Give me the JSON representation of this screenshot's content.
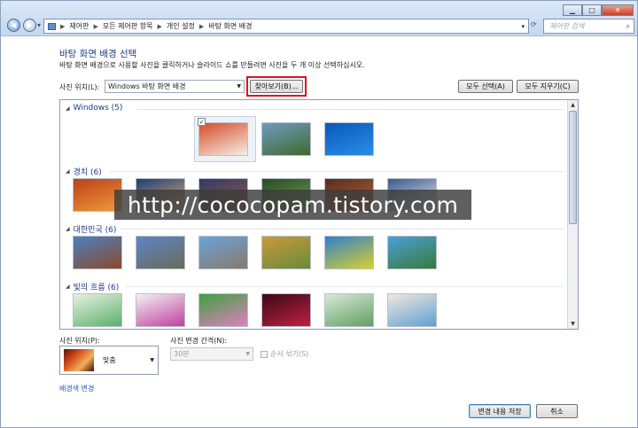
{
  "titlebar": {
    "controls": [
      "min",
      "max",
      "close"
    ],
    "address_crumbs": [
      "제어판",
      "모든 제어판 항목",
      "개인 설정",
      "바탕 화면 배경"
    ],
    "search_placeholder": "제어판 검색"
  },
  "page": {
    "title": "바탕 화면 배경 선택",
    "description": "바탕 화면 배경으로 사용할 사진을 클릭하거나 슬라이드 쇼를 만들려면 사진을 두 개 이상 선택하십시오."
  },
  "location": {
    "label": "사진 위치(L):",
    "value": "Windows 바탕 화면 배경",
    "browse_label": "찾아보기(B)..."
  },
  "actions": {
    "select_all": "모두 선택(A)",
    "clear_all": "모두 지우기(C)"
  },
  "gallery": {
    "groups": [
      {
        "label": "Windows (5)",
        "thumbs": [
          {
            "colors": [
              "#d84a2a",
              "#f5efe4"
            ],
            "name": "windows-thumb-1",
            "checked": true
          },
          {
            "colors": [
              "#6f9bc0",
              "#3f6a2b"
            ],
            "name": "windows-thumb-2"
          },
          {
            "colors": [
              "#0a58b8",
              "#2a8de8"
            ],
            "name": "windows-thumb-3"
          }
        ]
      },
      {
        "label": "경치 (6)",
        "thumbs": [
          {
            "colors": [
              "#b9401a",
              "#f29a3b"
            ],
            "name": "scenery-thumb-1"
          },
          {
            "colors": [
              "#1c3d7a",
              "#e7b36a"
            ],
            "name": "scenery-thumb-2"
          },
          {
            "colors": [
              "#2f3a6a",
              "#9b5a3a"
            ],
            "name": "scenery-thumb-3"
          },
          {
            "colors": [
              "#2a4a2a",
              "#6fa04f"
            ],
            "name": "scenery-thumb-4"
          },
          {
            "colors": [
              "#5a2a1a",
              "#b86a3a"
            ],
            "name": "scenery-thumb-5"
          },
          {
            "colors": [
              "#3a5a8a",
              "#f0f0f4"
            ],
            "name": "scenery-thumb-6"
          }
        ]
      },
      {
        "label": "대한민국 (6)",
        "thumbs": [
          {
            "colors": [
              "#4d7fbf",
              "#8a4a2a"
            ],
            "name": "korea-thumb-1"
          },
          {
            "colors": [
              "#5d86c4",
              "#6a6a5a"
            ],
            "name": "korea-thumb-2"
          },
          {
            "colors": [
              "#6aa3d8",
              "#8a7a6a"
            ],
            "name": "korea-thumb-3"
          },
          {
            "colors": [
              "#c89a3a",
              "#6a8a3a"
            ],
            "name": "korea-thumb-4"
          },
          {
            "colors": [
              "#2f7fd0",
              "#d8d02a"
            ],
            "name": "korea-thumb-5"
          },
          {
            "colors": [
              "#4a9fd8",
              "#3a7a3a"
            ],
            "name": "korea-thumb-6"
          }
        ]
      },
      {
        "label": "빛의 흐름 (6)",
        "thumbs": [
          {
            "colors": [
              "#e8f0e0",
              "#5ab06a"
            ],
            "name": "light-thumb-1"
          },
          {
            "colors": [
              "#f2f2f2",
              "#c040a0"
            ],
            "name": "light-thumb-2"
          },
          {
            "colors": [
              "#40a040",
              "#e080c0"
            ],
            "name": "light-thumb-3"
          },
          {
            "colors": [
              "#3a0a1a",
              "#c02040"
            ],
            "name": "light-thumb-4"
          },
          {
            "colors": [
              "#d8e8d8",
              "#60a060"
            ],
            "name": "light-thumb-5"
          },
          {
            "colors": [
              "#f0e8e0",
              "#60a0d0"
            ],
            "name": "light-thumb-6"
          }
        ]
      }
    ]
  },
  "watermark": "http://cococopam.tistory.com",
  "position": {
    "label": "사진 위치(P):",
    "value": "맞춤"
  },
  "interval": {
    "label": "사진 변경 간격(N):",
    "value": "30분",
    "shuffle_label": "순서 섞기(S)"
  },
  "footer": {
    "change_color_link": "배경색 변경",
    "save_label": "변경 내용 저장",
    "cancel_label": "취소"
  }
}
